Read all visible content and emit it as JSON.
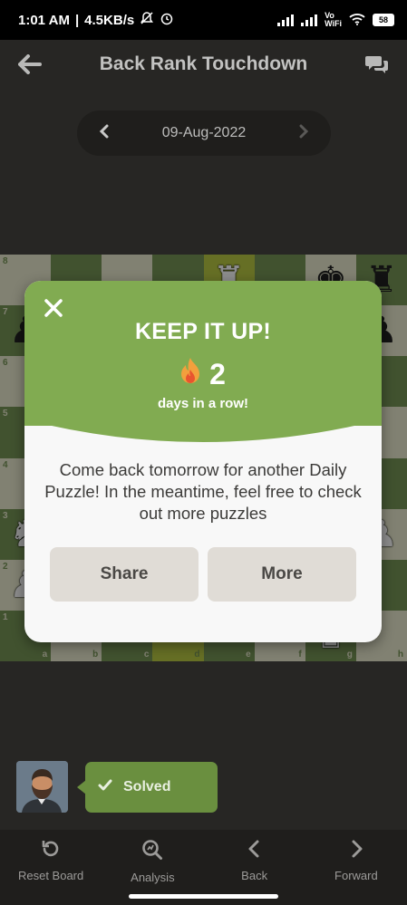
{
  "status": {
    "time": "1:01 AM",
    "speed": "4.5KB/s",
    "vowifi_top": "Vo",
    "vowifi_bottom": "WiFi",
    "battery": "58"
  },
  "header": {
    "title": "Back Rank Touchdown"
  },
  "date_picker": {
    "date": "09-Aug-2022"
  },
  "board": {
    "rank_labels": [
      "8",
      "7",
      "6",
      "5",
      "4",
      "3",
      "2",
      "1"
    ],
    "file_labels": [
      "a",
      "b",
      "c",
      "d",
      "e",
      "f",
      "g",
      "h"
    ]
  },
  "modal": {
    "title": "KEEP IT UP!",
    "streak_count": "2",
    "streak_label": "days in a row!",
    "message": "Come back tomorrow for another Daily Puzzle! In the meantime, feel free to check out more puzzles",
    "share_label": "Share",
    "more_label": "More"
  },
  "result": {
    "label": "Solved"
  },
  "bottom_nav": {
    "reset": "Reset Board",
    "analysis": "Analysis",
    "back": "Back",
    "forward": "Forward"
  },
  "colors": {
    "accent_green": "#81ab51",
    "solved_green": "#6a8f3f",
    "board_light": "#ebecd0",
    "board_dark": "#779556"
  }
}
